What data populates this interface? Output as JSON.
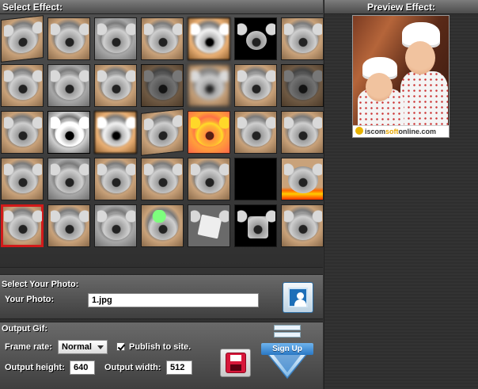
{
  "effects": {
    "title": "Select Effect:",
    "thumbnails": [
      {
        "name": "effect-1",
        "variant": "t-skew"
      },
      {
        "name": "effect-2",
        "variant": ""
      },
      {
        "name": "effect-3",
        "variant": "t-gray"
      },
      {
        "name": "effect-4",
        "variant": ""
      },
      {
        "name": "effect-5",
        "variant": "t-pixel"
      },
      {
        "name": "effect-6",
        "variant": "t-small"
      },
      {
        "name": "effect-7",
        "variant": ""
      },
      {
        "name": "effect-8",
        "variant": ""
      },
      {
        "name": "effect-9",
        "variant": "t-gray"
      },
      {
        "name": "effect-10",
        "variant": ""
      },
      {
        "name": "effect-11",
        "variant": "t-dark"
      },
      {
        "name": "effect-12",
        "variant": "t-blur"
      },
      {
        "name": "effect-13",
        "variant": ""
      },
      {
        "name": "effect-14",
        "variant": "t-dark"
      },
      {
        "name": "effect-15",
        "variant": ""
      },
      {
        "name": "effect-16",
        "variant": "t-noise"
      },
      {
        "name": "effect-17",
        "variant": "t-pixel"
      },
      {
        "name": "effect-18",
        "variant": "t-skew"
      },
      {
        "name": "effect-19",
        "variant": "t-red"
      },
      {
        "name": "effect-20",
        "variant": ""
      },
      {
        "name": "effect-21",
        "variant": ""
      },
      {
        "name": "effect-22",
        "variant": ""
      },
      {
        "name": "effect-23",
        "variant": "t-gray"
      },
      {
        "name": "effect-24",
        "variant": ""
      },
      {
        "name": "effect-25",
        "variant": ""
      },
      {
        "name": "effect-26",
        "variant": ""
      },
      {
        "name": "effect-27",
        "variant": "t-black"
      },
      {
        "name": "effect-28",
        "variant": "t-fire"
      },
      {
        "name": "effect-29",
        "variant": "t-selected"
      },
      {
        "name": "effect-30",
        "variant": ""
      },
      {
        "name": "effect-31",
        "variant": "t-gray"
      },
      {
        "name": "effect-32",
        "variant": "t-green"
      },
      {
        "name": "effect-33",
        "variant": "t-tilt"
      },
      {
        "name": "effect-34",
        "variant": "t-puzzle"
      },
      {
        "name": "effect-35",
        "variant": ""
      }
    ]
  },
  "photo": {
    "title": "Select Your Photo:",
    "label": "Your Photo:",
    "value": "1.jpg"
  },
  "output": {
    "title": "Output Gif:",
    "frame_rate_label": "Frame rate:",
    "frame_rate_value": "Normal",
    "publish_label": "Publish to site.",
    "publish_checked": true,
    "height_label": "Output height:",
    "height_value": "640",
    "width_label": "Output width:",
    "width_value": "512"
  },
  "signup": {
    "label": "Sign Up"
  },
  "preview": {
    "title": "Preview Effect:",
    "watermark_prefix": "iscom",
    "watermark_mid": "soft",
    "watermark_suffix": "online.com"
  },
  "colors": {
    "selected_outline": "#d21a1a",
    "signup_blue": "#2a78c4"
  }
}
